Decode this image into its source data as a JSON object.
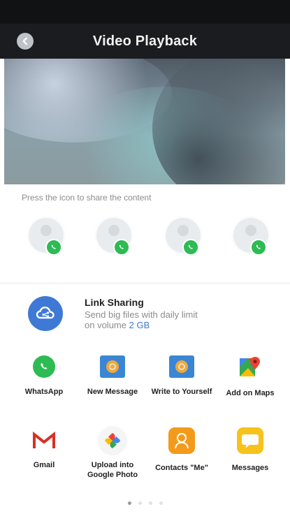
{
  "header": {
    "title": "Video Playback"
  },
  "share": {
    "hint": "Press the icon to share the content",
    "contacts": [
      {
        "badge_icon": "whatsapp-icon"
      },
      {
        "badge_icon": "whatsapp-icon"
      },
      {
        "badge_icon": "whatsapp-icon"
      },
      {
        "badge_icon": "whatsapp-icon"
      }
    ],
    "link_sharing": {
      "title": "Link Sharing",
      "desc_line1": "Send big files with daily limit",
      "desc_line2": "on volume",
      "quota": "2 GB"
    },
    "apps_row1": [
      {
        "label": "WhatsApp",
        "icon": "whatsapp-icon"
      },
      {
        "label": "New Message",
        "icon": "message-icon"
      },
      {
        "label": "Write to Yourself",
        "icon": "note-icon"
      },
      {
        "label": "Add on Maps",
        "icon": "maps-icon"
      }
    ],
    "apps_row2": [
      {
        "label": "Gmail",
        "icon": "gmail-icon"
      },
      {
        "label": "Upload into Google Photo",
        "label_line1": "Upload into",
        "label_line2": "Google Photo",
        "icon": "google-photos-icon"
      },
      {
        "label": "Contacts \"Me\"",
        "icon": "contacts-me-icon"
      },
      {
        "label": "Messages",
        "icon": "messages-icon"
      }
    ],
    "page_indicator": {
      "current": 1,
      "total": 4
    }
  },
  "colors": {
    "accent": "#3e79d6",
    "whatsapp": "#2dbb53",
    "gmail_red": "#d93025",
    "orange": "#f39a1a",
    "yellow": "#f6c21b"
  }
}
